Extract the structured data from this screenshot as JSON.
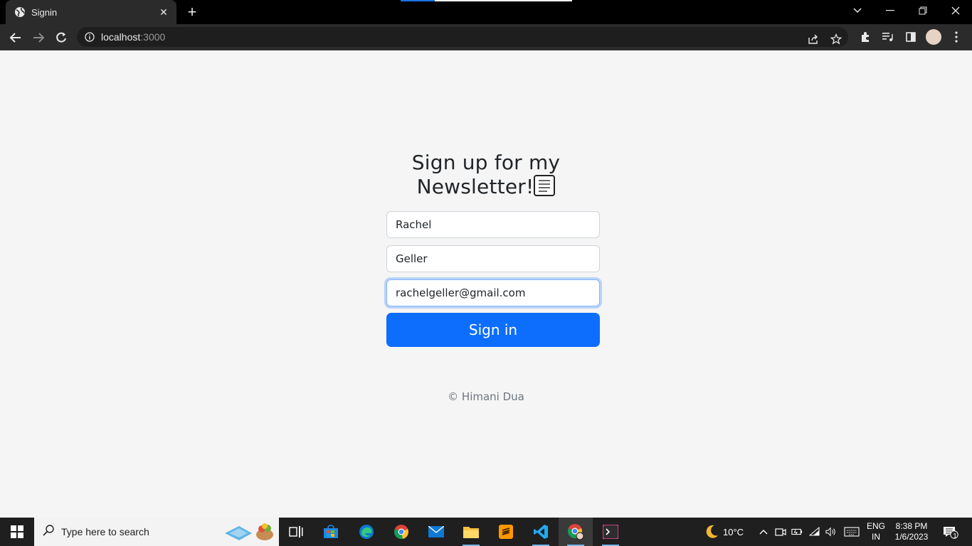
{
  "browser": {
    "tab": {
      "title": "Signin",
      "close": "✕"
    },
    "new_tab": "+",
    "address": {
      "host": "localhost",
      "port": ":3000"
    }
  },
  "page": {
    "heading_line1": "Sign up for my",
    "heading_line2": "Newsletter!",
    "fields": {
      "first_name": "Rachel",
      "last_name": "Geller",
      "email": "rachelgeller@gmail.com"
    },
    "submit_label": "Sign in",
    "footer": "© Himani Dua"
  },
  "taskbar": {
    "search_placeholder": "Type here to search",
    "weather": "10°C",
    "language": {
      "line1": "ENG",
      "line2": "IN"
    },
    "time": "8:38 PM",
    "date": "1/6/2023",
    "notifications_count": "1"
  },
  "colors": {
    "primary": "#0d6efd",
    "page_bg": "#f5f5f5",
    "chrome_dark": "#2b2b2b"
  }
}
